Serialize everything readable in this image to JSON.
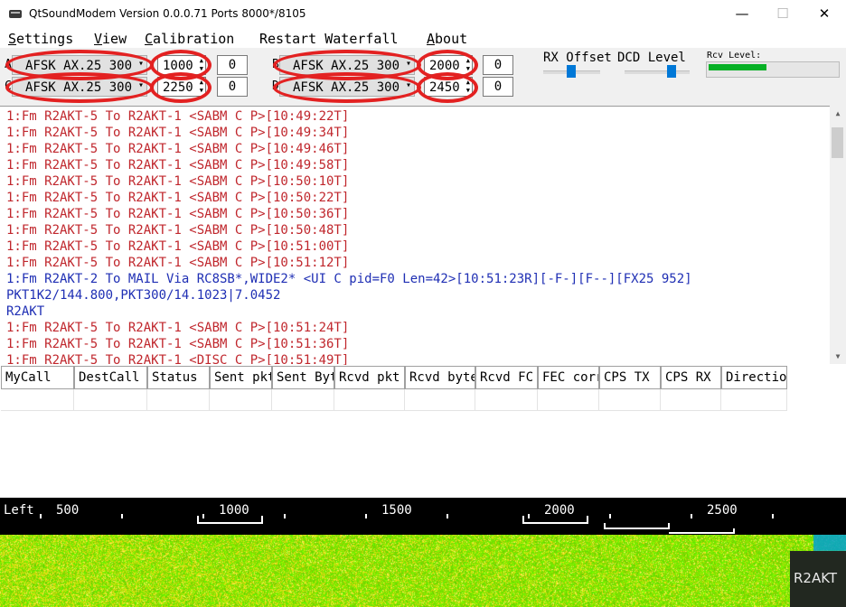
{
  "window": {
    "title": "QtSoundModem Version 0.0.0.71 Ports 8000*/8105",
    "minimize": "—",
    "maximize": "☐",
    "close": "✕"
  },
  "menu": [
    {
      "pre": "",
      "u": "S",
      "post": "ettings"
    },
    {
      "pre": "",
      "u": "V",
      "post": "iew"
    },
    {
      "pre": "",
      "u": "C",
      "post": "alibration"
    },
    {
      "pre": "Restart Waterfall",
      "u": "",
      "post": ""
    },
    {
      "pre": "",
      "u": "A",
      "post": "bout"
    }
  ],
  "channels": {
    "A": {
      "letter": "A",
      "mode": "AFSK AX.25 300",
      "freq": "1000",
      "offset": "0"
    },
    "B": {
      "letter": "B",
      "mode": "AFSK AX.25 300",
      "freq": "2000",
      "offset": "0"
    },
    "C": {
      "letter": "C",
      "mode": "AFSK AX.25 300",
      "freq": "2250",
      "offset": "0"
    },
    "D": {
      "letter": "D",
      "mode": "AFSK AX.25 300",
      "freq": "2450",
      "offset": "0"
    }
  },
  "rx_offset_label": "RX Offset",
  "dcd_label": "DCD Level",
  "rcv_level_label": "Rcv Level:",
  "rcv_level_fraction": 0.45,
  "log": [
    {
      "color": "red",
      "text": "1:Fm R2AKT-5 To R2AKT-1 <SABM C  P>[10:49:22T]"
    },
    {
      "color": "red",
      "text": "1:Fm R2AKT-5 To R2AKT-1 <SABM C  P>[10:49:34T]"
    },
    {
      "color": "red",
      "text": "1:Fm R2AKT-5 To R2AKT-1 <SABM C  P>[10:49:46T]"
    },
    {
      "color": "red",
      "text": "1:Fm R2AKT-5 To R2AKT-1 <SABM C  P>[10:49:58T]"
    },
    {
      "color": "red",
      "text": "1:Fm R2AKT-5 To R2AKT-1 <SABM C  P>[10:50:10T]"
    },
    {
      "color": "red",
      "text": "1:Fm R2AKT-5 To R2AKT-1 <SABM C  P>[10:50:22T]"
    },
    {
      "color": "red",
      "text": "1:Fm R2AKT-5 To R2AKT-1 <SABM C  P>[10:50:36T]"
    },
    {
      "color": "red",
      "text": "1:Fm R2AKT-5 To R2AKT-1 <SABM C  P>[10:50:48T]"
    },
    {
      "color": "red",
      "text": "1:Fm R2AKT-5 To R2AKT-1 <SABM C  P>[10:51:00T]"
    },
    {
      "color": "red",
      "text": "1:Fm R2AKT-5 To R2AKT-1 <SABM C  P>[10:51:12T]"
    },
    {
      "color": "blue",
      "text": "1:Fm R2AKT-2 To MAIL Via RC8SB*,WIDE2* <UI C pid=F0 Len=42>[10:51:23R][-F-][F--][FX25 952]"
    },
    {
      "color": "blue",
      "text": "PKT1K2/144.800,PKT300/14.1023|7.0452"
    },
    {
      "color": "blue",
      "text": "R2AKT"
    },
    {
      "color": "red",
      "text": "1:Fm R2AKT-5 To R2AKT-1 <SABM C  P>[10:51:24T]"
    },
    {
      "color": "red",
      "text": "1:Fm R2AKT-5 To R2AKT-1 <SABM C  P>[10:51:36T]"
    },
    {
      "color": "red",
      "text": "1:Fm R2AKT-5 To R2AKT-1 <DISC C  P>[10:51:49T]"
    }
  ],
  "table_headers": [
    "MyCall",
    "DestCall",
    "Status",
    "Sent pkt",
    "Sent Bytes",
    "Rcvd pkt",
    "Rcvd bytes",
    "Rcvd FC",
    "FEC corr",
    "CPS TX",
    "CPS RX",
    "Direction"
  ],
  "waterfall": {
    "left_label": "Left",
    "ticks": [
      "500",
      "1000",
      "1500",
      "2000",
      "2500"
    ]
  },
  "logo_text": "R2AKT",
  "colors": {
    "log_red": "#c0272d",
    "log_blue": "#1f2fb4",
    "annotation_red": "#e32121",
    "level_green": "#06b025"
  }
}
